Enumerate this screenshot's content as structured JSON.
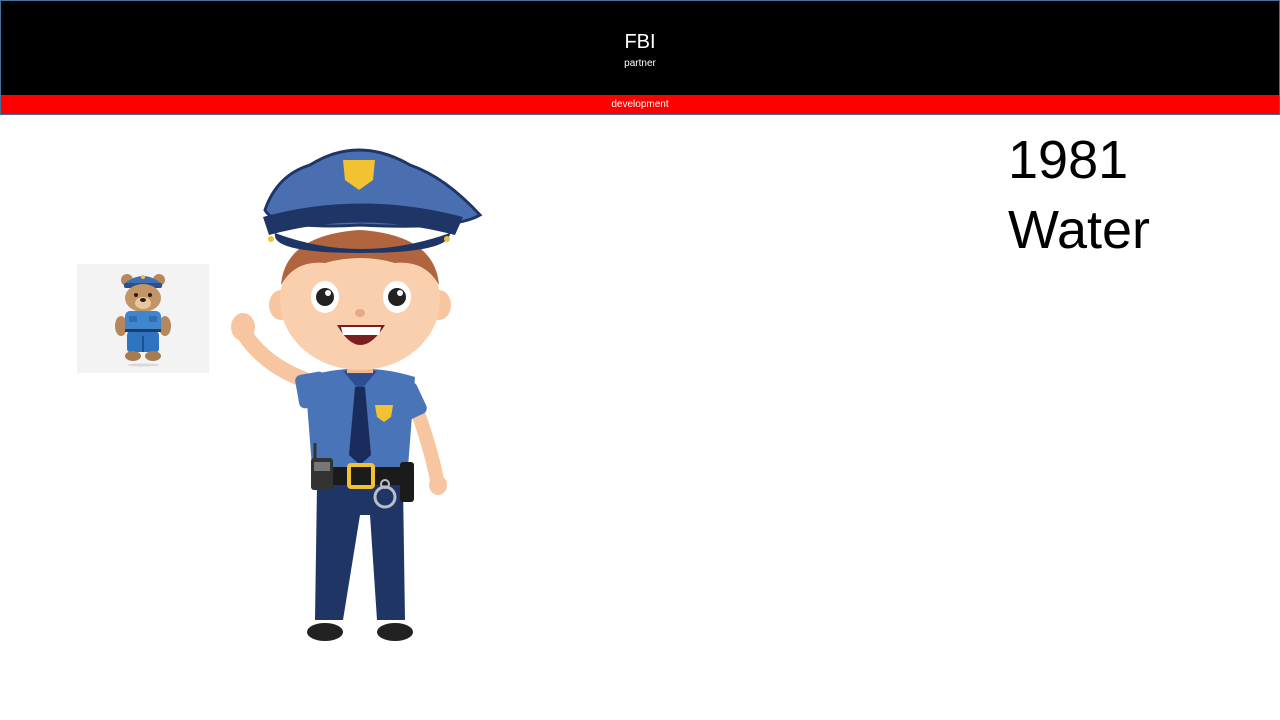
{
  "header": {
    "title": "FBI",
    "subtitle": "partner",
    "background": "#000000"
  },
  "ribbon": {
    "label": "development",
    "color": "#ff0000"
  },
  "main": {
    "year": "1981",
    "word": "Water"
  },
  "images": {
    "thumbnail": "police-teddy-bear-image",
    "main": "cartoon-police-officer-image"
  }
}
